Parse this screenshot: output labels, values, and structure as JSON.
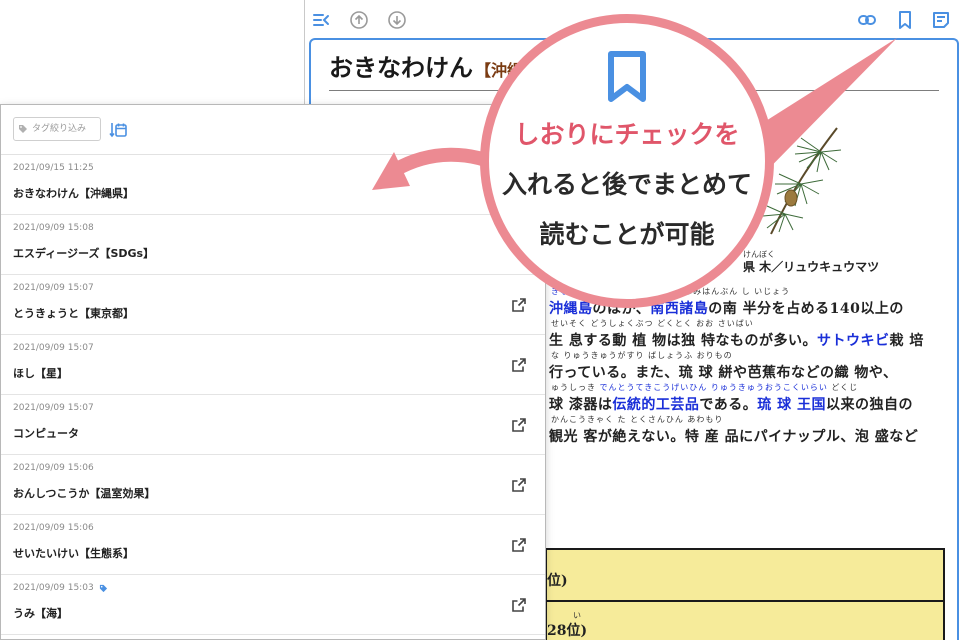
{
  "viewer": {
    "title_kana": "おきなわけん",
    "title_kanji": "【沖縄",
    "tree_ruby": "けんぼく",
    "tree_name": "県 木／リュウキュウマツ",
    "ruby_lines": [
      {
        "plain": "  ",
        "blue": "きなわじま    なんせいしょとう",
        "plain2": "  みなみはんぶん   し          いじょう"
      },
      {
        "plain": "    せいそく      どうしょくぶつ  どくとく                    おお                     さいばい",
        "blue": "",
        "plain2": ""
      },
      {
        "plain": " な                               りゅうきゅうがすり   ばしょうふ          おりもの",
        "blue": "",
        "plain2": ""
      },
      {
        "plain": "ゅうしっき  ",
        "blue": "でんとうてきこうげいひん          りゅうきゅうおうこくいらい",
        "plain2": "   どくじ"
      },
      {
        "plain": "かんこうきゃく   た                     とくさんひん                  あわもり",
        "blue": "",
        "plain2": ""
      }
    ],
    "body_lines": [
      {
        "parts": [
          {
            "t": "沖縄島",
            "link": true
          },
          {
            "t": "のほか、",
            "link": false
          },
          {
            "t": "南西諸島",
            "link": true
          },
          {
            "t": "の南 半分を占める140以上の",
            "link": false
          }
        ]
      },
      {
        "parts": [
          {
            "t": "生 息する動 植 物は独 特なものが多い。",
            "link": false
          },
          {
            "t": "サトウキビ",
            "link": true
          },
          {
            "t": "栽 培",
            "link": false
          }
        ]
      },
      {
        "parts": [
          {
            "t": "行っている。また、琉 球 絣や芭蕉布などの織 物や、",
            "link": false
          }
        ]
      },
      {
        "parts": [
          {
            "t": "球 漆器は",
            "link": false
          },
          {
            "t": "伝統的工芸品",
            "link": true
          },
          {
            "t": "である。",
            "link": false
          },
          {
            "t": "琉 球 王国",
            "link": true
          },
          {
            "t": "以来の独自の",
            "link": false
          }
        ]
      },
      {
        "parts": [
          {
            "t": "観光 客が絶えない。特 産 品にパイナップル、泡 盛など",
            "link": false
          }
        ]
      }
    ],
    "rank_1": "位)",
    "rank_2_ruby": "い",
    "rank_2": "28位)"
  },
  "list": {
    "tag_filter_placeholder": "タグ絞り込み",
    "items": [
      {
        "date": "2021/09/15 11:25",
        "title": "おきなわけん【沖縄県】",
        "tagged": false,
        "has_open": false
      },
      {
        "date": "2021/09/09 15:08",
        "title": "エスディージーズ【SDGs】",
        "tagged": false,
        "has_open": false
      },
      {
        "date": "2021/09/09 15:07",
        "title": "とうきょうと【東京都】",
        "tagged": false,
        "has_open": true
      },
      {
        "date": "2021/09/09 15:07",
        "title": "ほし【星】",
        "tagged": false,
        "has_open": true
      },
      {
        "date": "2021/09/09 15:07",
        "title": "コンピュータ",
        "tagged": false,
        "has_open": true
      },
      {
        "date": "2021/09/09 15:06",
        "title": "おんしつこうか【温室効果】",
        "tagged": false,
        "has_open": true
      },
      {
        "date": "2021/09/09 15:06",
        "title": "せいたいけい【生態系】",
        "tagged": false,
        "has_open": true
      },
      {
        "date": "2021/09/09 15:03",
        "title": "うみ【海】",
        "tagged": true,
        "has_open": true
      }
    ]
  },
  "callout": {
    "line1": "しおりにチェックを",
    "line2": "入れると後でまとめて",
    "line3": "読むことが可能"
  },
  "colors": {
    "accent_blue": "#4a90e2",
    "link_blue": "#1a2fd8",
    "callout_pink": "#ec8a92",
    "callout_text_pink": "#e0566a",
    "rank_box_yellow": "#f6eb9a"
  },
  "icons": {
    "toolbar": [
      "list-collapse-icon",
      "arrow-up-circle-icon",
      "arrow-down-circle-icon",
      "link-icon",
      "bookmark-icon",
      "notes-icon"
    ],
    "list": [
      "tag-icon",
      "calendar-sort-icon",
      "open-external-icon"
    ]
  }
}
